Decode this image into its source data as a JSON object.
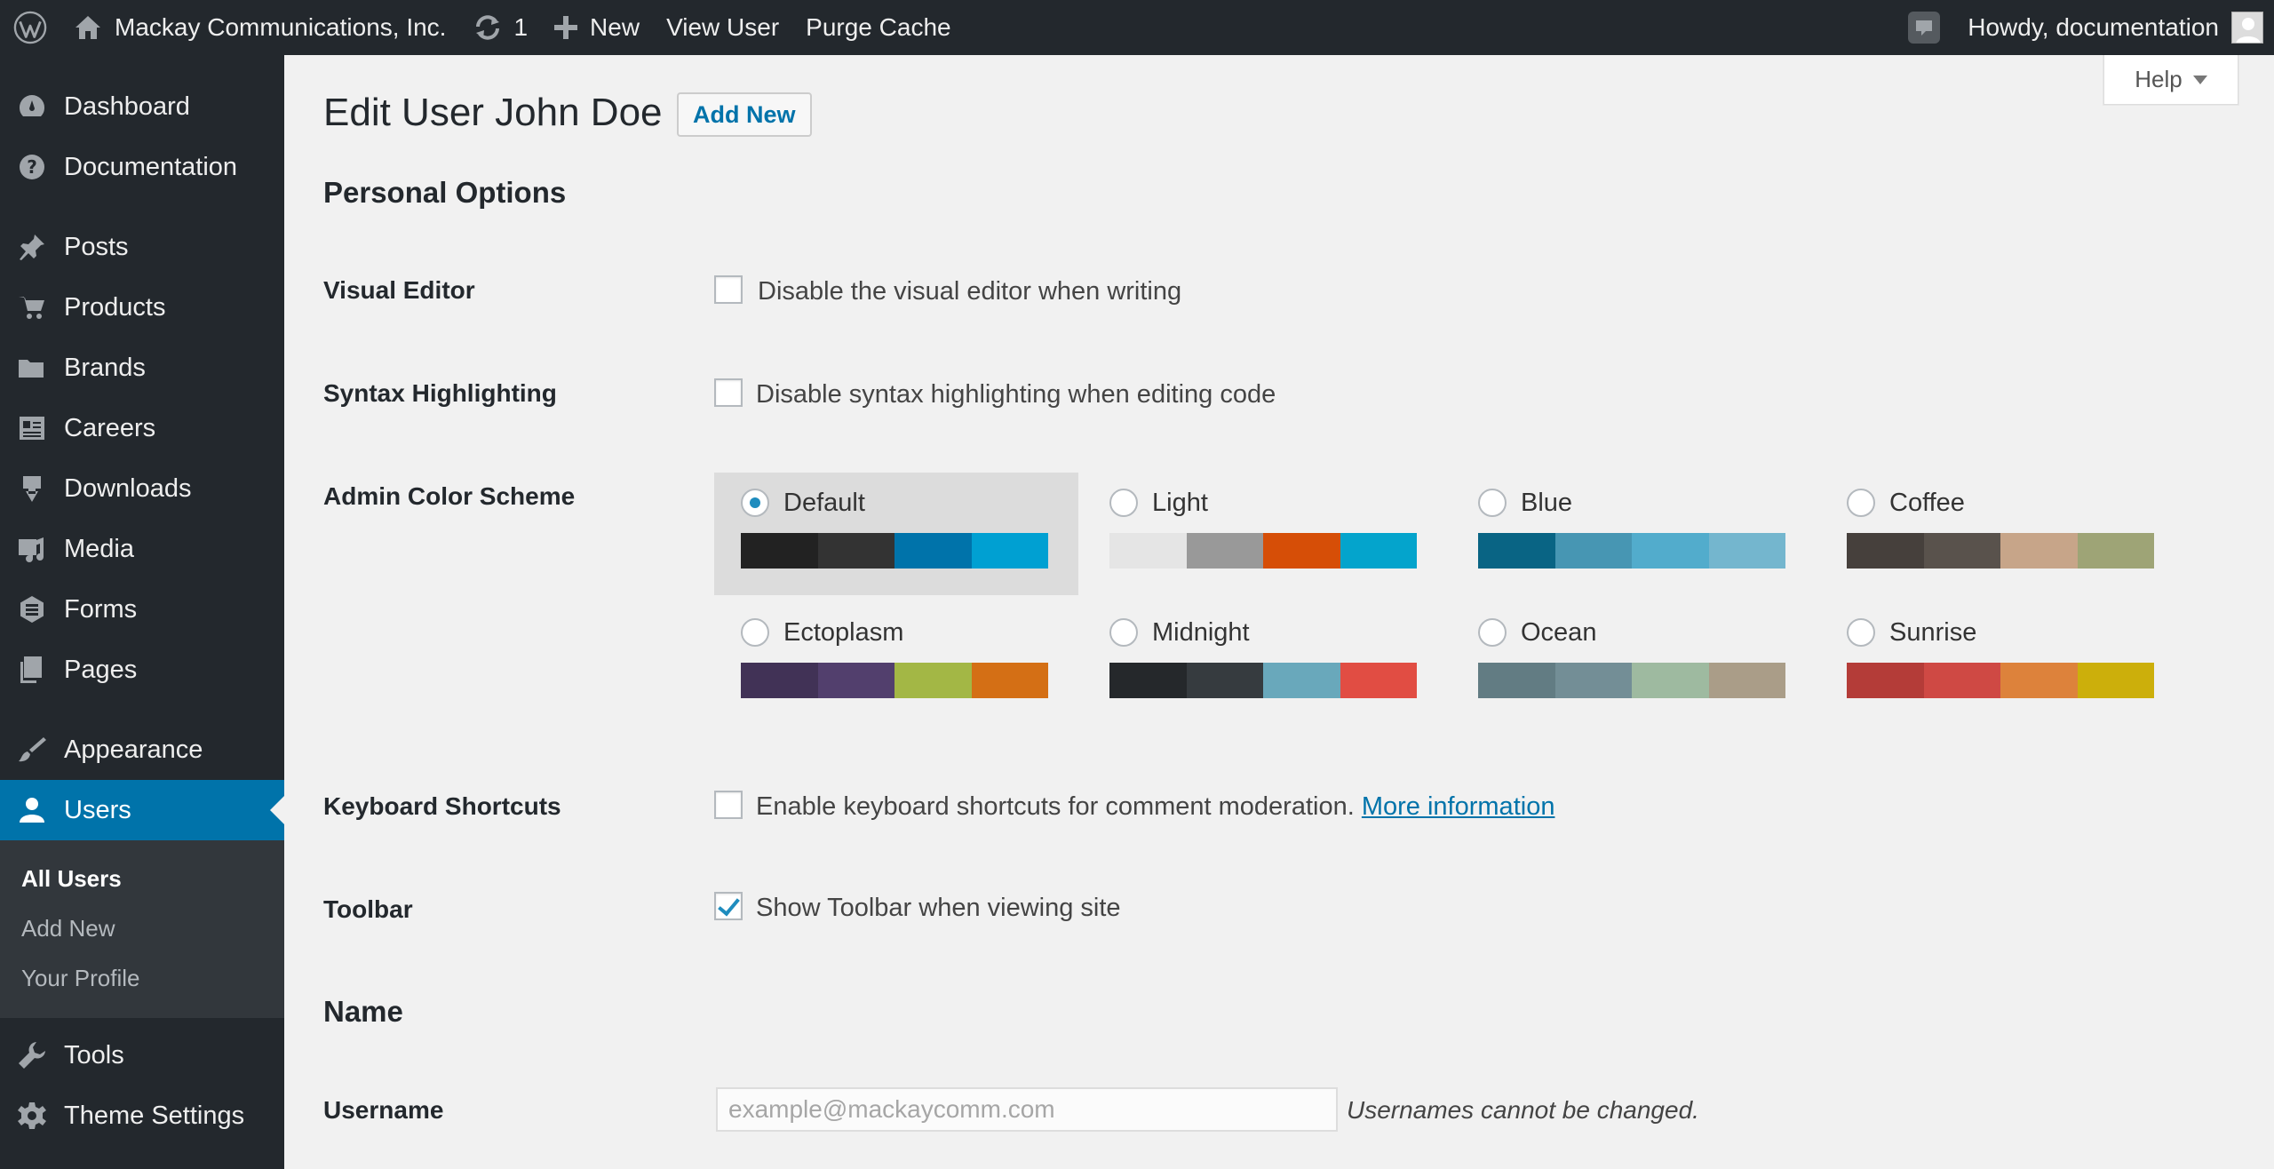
{
  "adminbar": {
    "site_name": "Mackay Communications, Inc.",
    "updates_count": "1",
    "new_label": "New",
    "view_user_label": "View User",
    "purge_cache_label": "Purge Cache",
    "greeting": "Howdy, documentation"
  },
  "sidebar": {
    "items": [
      {
        "label": "Dashboard",
        "icon": "dashboard-icon"
      },
      {
        "label": "Documentation",
        "icon": "help-icon"
      },
      {
        "label": "Posts",
        "icon": "pin-icon"
      },
      {
        "label": "Products",
        "icon": "cart-icon"
      },
      {
        "label": "Brands",
        "icon": "folder-icon"
      },
      {
        "label": "Careers",
        "icon": "id-card-icon"
      },
      {
        "label": "Downloads",
        "icon": "download-icon"
      },
      {
        "label": "Media",
        "icon": "media-icon"
      },
      {
        "label": "Forms",
        "icon": "forms-icon"
      },
      {
        "label": "Pages",
        "icon": "pages-icon"
      },
      {
        "label": "Appearance",
        "icon": "paintbrush-icon"
      },
      {
        "label": "Users",
        "icon": "user-icon"
      },
      {
        "label": "Tools",
        "icon": "wrench-icon"
      },
      {
        "label": "Theme Settings",
        "icon": "gear-icon"
      }
    ],
    "submenu": [
      "All Users",
      "Add New",
      "Your Profile"
    ]
  },
  "header": {
    "help_label": "Help",
    "title": "Edit User John Doe",
    "add_new_label": "Add New"
  },
  "personal_options": {
    "heading": "Personal Options",
    "visual_editor": {
      "label": "Visual Editor",
      "text": "Disable the visual editor when writing",
      "checked": false
    },
    "syntax": {
      "label": "Syntax Highlighting",
      "text": "Disable syntax highlighting when editing code",
      "checked": false
    },
    "color_scheme": {
      "label": "Admin Color Scheme",
      "selected": "Default",
      "schemes": [
        {
          "name": "Default",
          "colors": [
            "#222222",
            "#333333",
            "#0073aa",
            "#00a0d2"
          ]
        },
        {
          "name": "Light",
          "colors": [
            "#e5e5e5",
            "#999999",
            "#d64e07",
            "#04a4cc"
          ]
        },
        {
          "name": "Blue",
          "colors": [
            "#096484",
            "#4796b3",
            "#52accc",
            "#74b6ce"
          ]
        },
        {
          "name": "Coffee",
          "colors": [
            "#46403c",
            "#59524c",
            "#c7a589",
            "#9ea476"
          ]
        },
        {
          "name": "Ectoplasm",
          "colors": [
            "#413256",
            "#523f6d",
            "#a3b745",
            "#d46f15"
          ]
        },
        {
          "name": "Midnight",
          "colors": [
            "#25282b",
            "#363b3f",
            "#69a8bb",
            "#e14d43"
          ]
        },
        {
          "name": "Ocean",
          "colors": [
            "#627c83",
            "#738e96",
            "#9ebaa0",
            "#aa9d88"
          ]
        },
        {
          "name": "Sunrise",
          "colors": [
            "#b43c38",
            "#cf4944",
            "#dd823b",
            "#ccaf0b"
          ]
        }
      ]
    },
    "keyboard": {
      "label": "Keyboard Shortcuts",
      "text": "Enable keyboard shortcuts for comment moderation.",
      "link": "More information",
      "checked": false
    },
    "toolbar": {
      "label": "Toolbar",
      "text": "Show Toolbar when viewing site",
      "checked": true
    }
  },
  "name_section": {
    "heading": "Name",
    "username_label": "Username",
    "username_value": "example@mackaycomm.com",
    "username_note": "Usernames cannot be changed."
  }
}
